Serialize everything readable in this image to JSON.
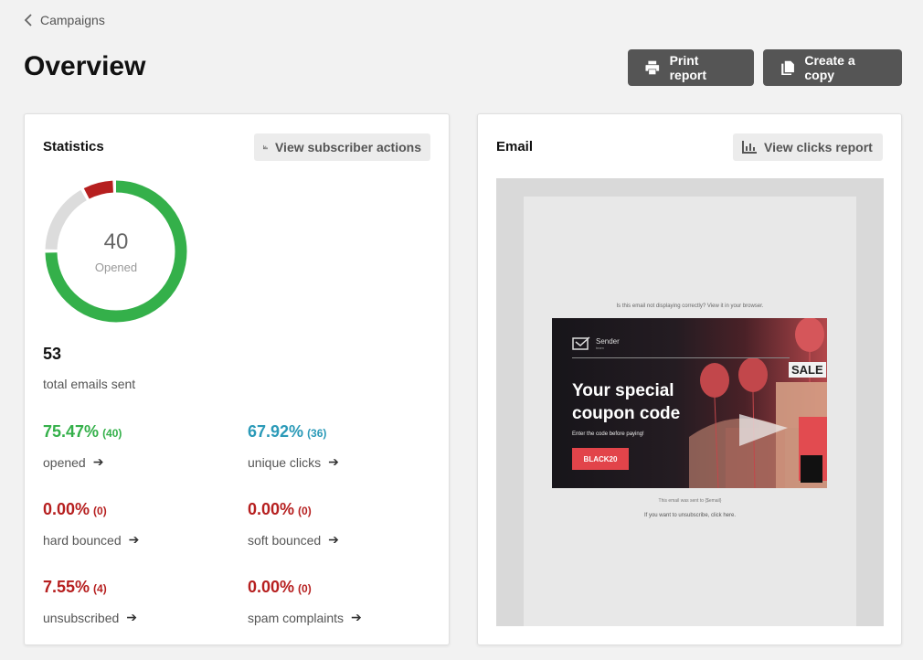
{
  "breadcrumb": {
    "label": "Campaigns"
  },
  "page": {
    "title": "Overview"
  },
  "actions": {
    "print": "Print report",
    "copy": "Create a copy"
  },
  "statistics": {
    "title": "Statistics",
    "view_button": "View subscriber actions",
    "donut": {
      "number": "40",
      "label": "Opened",
      "segments": [
        {
          "name": "opened",
          "fraction": 0.7547,
          "color": "#34b04a"
        },
        {
          "name": "not-opened",
          "fraction": 0.1698,
          "color": "#dcdcdc"
        },
        {
          "name": "hard-bounced",
          "fraction": 0.0,
          "color": "#b61f1f"
        },
        {
          "name": "unsubscribed",
          "fraction": 0.0755,
          "color": "#b61f1f"
        }
      ]
    },
    "total": {
      "value": "53",
      "label": "total emails sent"
    },
    "metrics": [
      {
        "pct": "75.47%",
        "count": "(40)",
        "label": "opened"
      },
      {
        "pct": "67.92%",
        "count": "(36)",
        "label": "unique clicks"
      },
      {
        "pct": "0.00%",
        "count": "(0)",
        "label": "hard bounced"
      },
      {
        "pct": "0.00%",
        "count": "(0)",
        "label": "soft bounced"
      },
      {
        "pct": "7.55%",
        "count": "(4)",
        "label": "unsubscribed"
      },
      {
        "pct": "0.00%",
        "count": "(0)",
        "label": "spam complaints"
      }
    ]
  },
  "email": {
    "title": "Email",
    "view_button": "View clicks report",
    "preview": {
      "top_text": "Is this email not displaying correctly? View it in your browser.",
      "brand_name": "Sender",
      "brand_sub": "team",
      "sale": "SALE",
      "headline": "Your special coupon code",
      "subline": "Enter the code before paying!",
      "coupon": "BLACK20",
      "footer1": "This email was sent to {$email}",
      "footer2": "If you want to unsubscribe, click here."
    }
  },
  "colors": {
    "green": "#34b04a",
    "teal": "#2b9ab8",
    "red": "#b61f1f",
    "button_dark": "#555555"
  },
  "icons": [
    "chevron-left-icon",
    "printer-icon",
    "copy-icon",
    "bar-chart-icon",
    "arrow-right-icon",
    "envelope-check-icon"
  ]
}
